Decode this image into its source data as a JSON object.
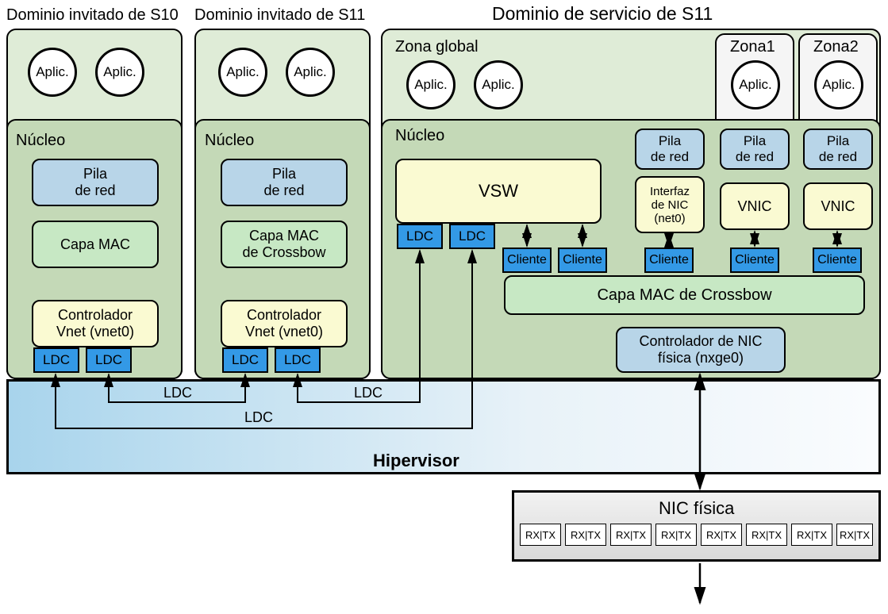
{
  "titles": {
    "s10": "Dominio invitado de S10",
    "s11": "Dominio invitado de S11",
    "service": "Dominio de servicio de S11"
  },
  "common": {
    "app": "Aplic.",
    "kernel": "Núcleo",
    "netstack1": "Pila",
    "netstack2": "de red",
    "mac_s10": "Capa MAC",
    "mac_s11_1": "Capa MAC",
    "mac_s11_2": "de Crossbow",
    "vnet1": "Controlador",
    "vnet2": "Vnet (vnet0)",
    "ldc": "LDC",
    "ldc_lbl": "LDC"
  },
  "service": {
    "global_zone": "Zona global",
    "zone1": "Zona1",
    "zone2": "Zona2",
    "vsw": "VSW",
    "nicif1": "Interfaz",
    "nicif2": "de NIC",
    "nicif3": "(net0)",
    "vnic": "VNIC",
    "cliente": "Cliente",
    "crossbow": "Capa MAC de Crossbow",
    "nicdrv1": "Controlador de NIC",
    "nicdrv2": "física (nxge0)"
  },
  "hypervisor": "Hipervisor",
  "nic": {
    "title": "NIC física",
    "rxtx": "RX|TX"
  }
}
